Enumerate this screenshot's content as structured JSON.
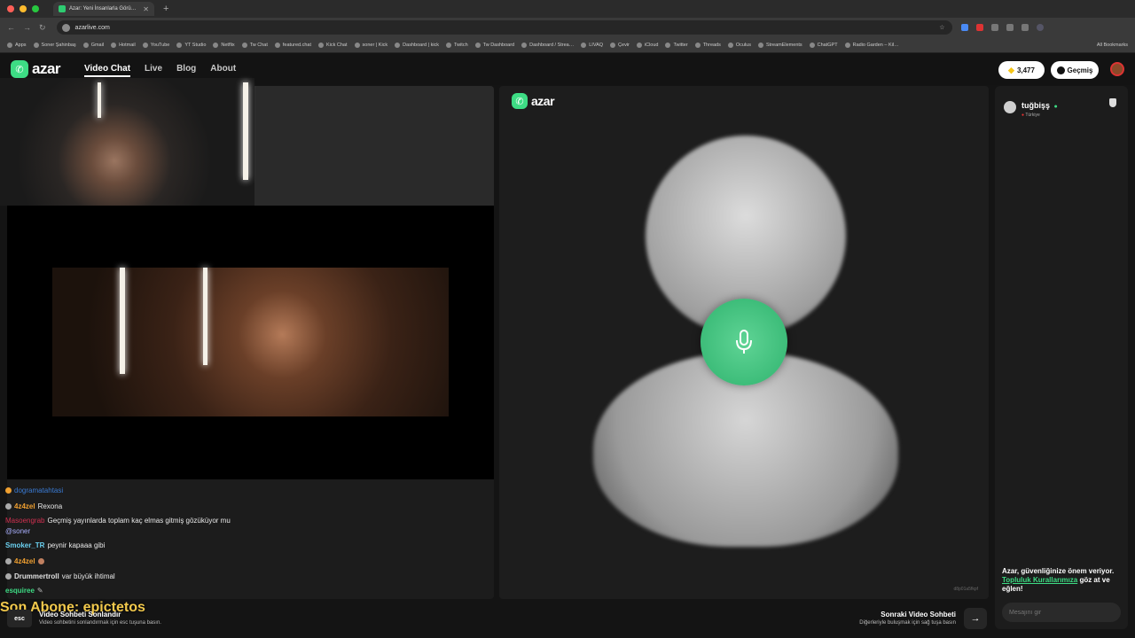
{
  "browser": {
    "tab_title": "Azar: Yeni İnsanlarla Görü…",
    "url": "azarlive.com",
    "bookmarks": [
      "Apps",
      "Soner Şahinbaş",
      "Gmail",
      "Hotmail",
      "YouTube",
      "YT Studio",
      "Netflix",
      "Tw Chat",
      "featured.chat",
      "Kick Chat",
      "soner | Kick",
      "Dashboard | kick",
      "Twitch",
      "Tw Dashboard",
      "Dashboard / Strea…",
      "LIVAQ",
      "Çevir",
      "iCloud",
      "Twitter",
      "Threads",
      "Oculus",
      "StreamElements",
      "ChatGPT",
      "Radio Garden – Kil…"
    ],
    "all_bookmarks": "All Bookmarks"
  },
  "header": {
    "logo": "azar",
    "nav": [
      "Video Chat",
      "Live",
      "Blog",
      "About"
    ],
    "coins": "3,477",
    "history": "Geçmiş"
  },
  "chat": [
    {
      "user": "dogramatahtasi",
      "text": "",
      "color": "#3a7bd5"
    },
    {
      "user": "4z4zel",
      "text": "Rexona",
      "color": "#f0a030"
    },
    {
      "user": "Masoengrab",
      "text": "Geçmiş yayınlarda toplam kaç elmas gitmiş gözüküyor mu",
      "color": "#d03050"
    },
    {
      "user": "",
      "text": "@soner",
      "color": "#aab0ff"
    },
    {
      "user": "Smoker_TR",
      "text": "peynir kapaaa gibi",
      "color": "#6ad0f0"
    },
    {
      "user": "4z4zel",
      "text": "",
      "color": "#f0a030"
    },
    {
      "user": "Drummertroll",
      "text": "var büyük ihtimal",
      "color": "#e0e0e0"
    },
    {
      "user": "esquiree",
      "text": "",
      "color": "#3ddc84"
    }
  ],
  "subscriber": "Son Abone: epictetos",
  "main": {
    "logo": "azar",
    "id_text": "d8p01a5fkpf"
  },
  "peer": {
    "name": "tuğbişş",
    "country": "Türkiye"
  },
  "safety": {
    "text1": "Azar, güvenliğinize önem veriyor.",
    "link": "Topluluk Kurallarımıza",
    "text2": "göz at ve eğlen!"
  },
  "message_placeholder": "Mesajını gir",
  "bottom": {
    "esc": "esc",
    "end_title": "Video Sohbeti Sonlandır",
    "end_desc": "Video sohbetini sonlandırmak için esc tuşuna basın.",
    "next_title": "Sonraki Video Sohbeti",
    "next_desc": "Diğerleriyle buluşmak için sağ tuşa basın"
  }
}
